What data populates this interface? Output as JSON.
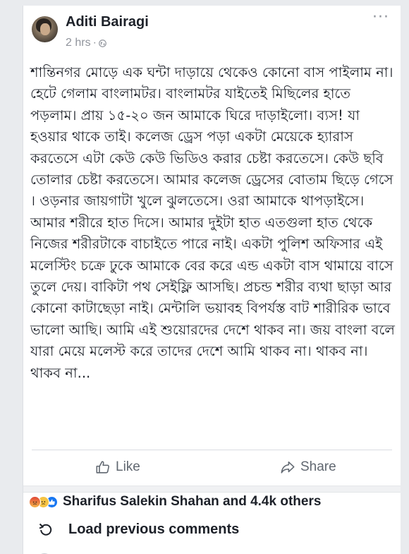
{
  "post": {
    "author": "Aditi Bairagi",
    "time": "2 hrs",
    "separator": "·",
    "privacy_icon": "globe-icon",
    "more_icon": "more-dots-icon",
    "text": "শান্তিনগর মোড়ে এক ঘন্টা দাড়ায়ে থেকেও কোনো বাস পাইলাম না। হেটে গেলাম বাংলামটর। বাংলামটর যাইতেই মিছিলের হাতে পড়লাম। প্রায় ১৫-২০ জন আমাকে ঘিরে দাড়াইলো। ব্যস! যা হওয়ার থাকে তাই। কলেজ ড্রেস পড়া একটা মেয়েকে হ্যারাস করতেসে এটা কেউ কেউ ভিডিও করার চেষ্টা করতেসে। কেউ ছবি তোলার চেষ্টা করতেসে। আমার কলেজ ড্রেসের বোতাম ছিড়ে গেসে । ওড়নার জায়গাটা খুলে ঝুলতেসে। ওরা আমাকে থাপড়াইসে। আমার শরীরে হাত দিসে। আমার দুইটা হাত এতগুলা হাত থেকে নিজের শরীরটাকে বাচাইতে পারে নাই। একটা পুলিশ অফিসার এই মলেস্টিং চক্রে ঢুকে আমাকে বের করে এন্ড একটা বাস থামায়ে বাসে তুলে দেয়। বাকিটা পথ সেইফ্লি আসছি। প্রচন্ড শরীর ব্যথা ছাড়া আর কোনো কাটাছেড়া নাই। মেন্টালি ভয়াবহ বিপর্যস্ত বাট শারীরিক ভাবে ভালো আছি। আমি এই শুয়োরদের দেশে থাকব না। জয় বাংলা বলে যারা মেয়ে মলেস্ট করে তাদের দেশে আমি থাকব না। থাকব না। থাকব না..."
  },
  "actions": {
    "like_label": "Like",
    "share_label": "Share",
    "like_icon": "thumbs-up-icon",
    "share_icon": "share-arrow-icon"
  },
  "reactions": {
    "icons": [
      "angry-reaction-icon",
      "sad-reaction-icon",
      "like-reaction-icon"
    ],
    "summary": "Sharifus Salekin Shahan and 4.4k others"
  },
  "comments": {
    "load_previous_label": "Load previous comments",
    "load_icon": "refresh-icon"
  },
  "colors": {
    "background": "#e9ebee",
    "card": "#ffffff",
    "text_primary": "#1d2129",
    "text_secondary": "#90949c",
    "action_gray": "#606770",
    "like_blue": "#1877f2"
  }
}
